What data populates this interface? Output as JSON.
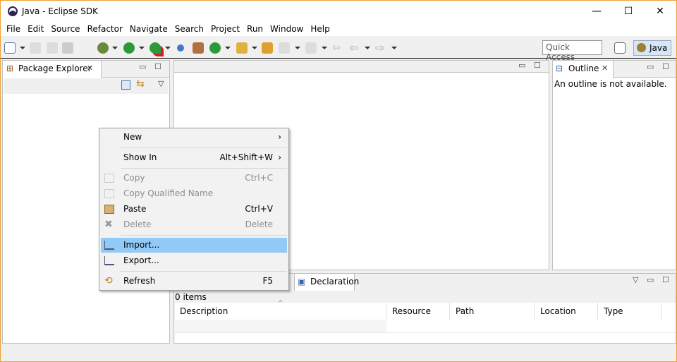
{
  "window": {
    "title": "Java - Eclipse SDK",
    "minimize": "—",
    "maximize": "☐",
    "close": "✕"
  },
  "menubar": [
    "File",
    "Edit",
    "Source",
    "Refactor",
    "Navigate",
    "Search",
    "Project",
    "Run",
    "Window",
    "Help"
  ],
  "toolbar": {
    "quick_access_placeholder": "Quick Access",
    "perspective": "Java"
  },
  "package_explorer": {
    "tab": "Package Explorer"
  },
  "outline": {
    "tab": "Outline",
    "message": "An outline is not available."
  },
  "bottom": {
    "tab": "Declaration",
    "count": "0 items",
    "columns": [
      "Description",
      "Resource",
      "Path",
      "Location",
      "Type"
    ]
  },
  "context_menu": {
    "items": [
      {
        "label": "New",
        "shortcut": "",
        "submenu": true,
        "enabled": true
      },
      {
        "label": "Show In",
        "shortcut": "Alt+Shift+W",
        "submenu": true,
        "enabled": true
      },
      {
        "label": "Copy",
        "shortcut": "Ctrl+C",
        "enabled": false
      },
      {
        "label": "Copy Qualified Name",
        "shortcut": "",
        "enabled": false
      },
      {
        "label": "Paste",
        "shortcut": "Ctrl+V",
        "enabled": true
      },
      {
        "label": "Delete",
        "shortcut": "Delete",
        "enabled": false
      },
      {
        "label": "Import...",
        "shortcut": "",
        "enabled": true,
        "highlighted": true
      },
      {
        "label": "Export...",
        "shortcut": "",
        "enabled": true
      },
      {
        "label": "Refresh",
        "shortcut": "F5",
        "enabled": true
      }
    ],
    "arrow": "›"
  },
  "colors": {
    "highlight": "#91c9f7",
    "window_border": "#f0a030"
  }
}
